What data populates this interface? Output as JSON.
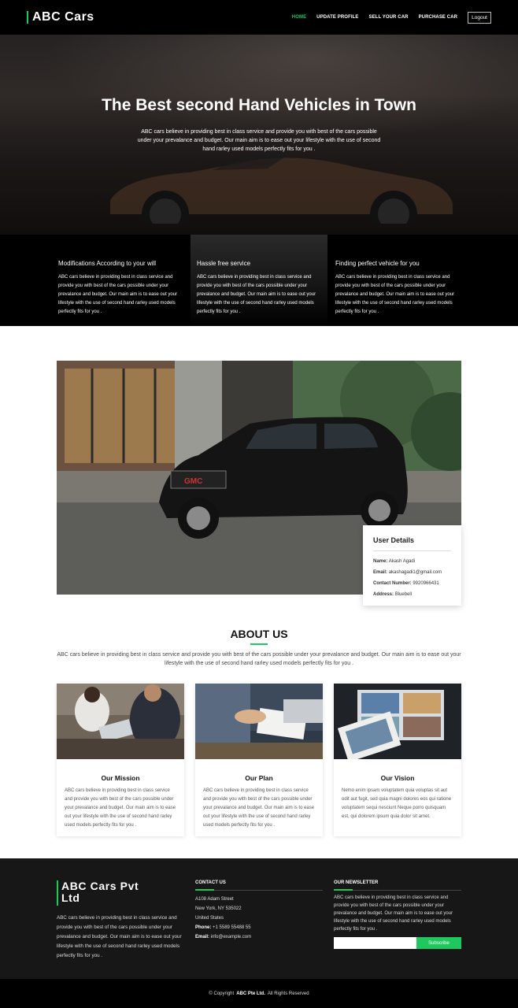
{
  "nav": {
    "brand": "ABC Cars",
    "links": [
      "HOME",
      "UPDATE PROFILE",
      "SELL YOUR CAR",
      "PURCHASE CAR"
    ],
    "logout": "Logout"
  },
  "hero": {
    "title": "The Best second Hand Vehicles in Town",
    "text": "ABC cars believe in providing best in class service and provide you with best of the cars possible under your prevalance and budget. Our main aim is to ease out your lifestyle with the use of second hand rarley used models perfectly fits for you ."
  },
  "features": [
    {
      "title": "Modifications According to your will",
      "text": "ABC cars believe in providing best in class service and provide you with best of the cars possible under your prevalance and budget. Our main aim is to ease out your lifestyle with the use of second hand rarley used models perfectly fits for you ."
    },
    {
      "title": "Hassle free service",
      "text": "ABC cars believe in providing best in class service and provide you with best of the cars possible under your prevalance and budget. Our main aim is to ease out your lifestyle with the use of second hand rarley used models perfectly fits for you ."
    },
    {
      "title": "Finding perfect vehicle for you",
      "text": "ABC cars believe in providing best in class service and provide you with best of the cars possible under your prevalance and budget. Our main aim is to ease out your lifestyle with the use of second hand rarley used models perfectly fits for you ."
    }
  ],
  "user": {
    "title": "User Details",
    "name_label": "Name:",
    "name": "Akash Agadi",
    "email_label": "Email:",
    "email": "akashagadi1@gmail.com",
    "phone_label": "Contact Number:",
    "phone": "9920966431",
    "address_label": "Address:",
    "address": "Bluebell"
  },
  "about": {
    "title": "ABOUT US",
    "text": "ABC cars believe in providing best in class service and provide you with best of the cars possible under your prevalance and budget. Our main aim is to ease out your lifestyle with the use of second hand rarley used models perfectly fits for you .",
    "cards": [
      {
        "title": "Our Mission",
        "text": "ABC cars believe in providing best in class service and provide you with best of the cars possible under your prevalance and budget. Our main aim is to ease out your lifestyle with the use of second hand rarley used models perfectly fits for you ."
      },
      {
        "title": "Our Plan",
        "text": "ABC cars believe in providing best in class service and provide you with best of the cars possible under your prevalance and budget. Our main aim is to ease out your lifestyle with the use of second hand rarley used models perfectly fits for you ."
      },
      {
        "title": "Our Vision",
        "text": "Nemo enim ipsam voluptatem quia voluptas sit aut odit aut fugit, sed quia magni dolores eos qui ratione voluptatem sequi nesciunt Neque porro quisquam est, qui dolorem ipsum quia dolor sit amet."
      }
    ]
  },
  "footer": {
    "brand_line1": "ABC Cars Pvt",
    "brand_line2": "Ltd",
    "desc": "ABC cars believe in providing best in class service and provide you with best of the cars possible under your prevalance and budget. Our main aim is to ease out your lifestyle with the use of second hand rarley used models perfectly fits for you .",
    "contact_title": "CONTACT US",
    "address1": "A108 Adam Street",
    "address2": "New York, NY 535022",
    "country": "United States",
    "phone_label": "Phone:",
    "phone": "+1 5589 55488 55",
    "email_label": "Email:",
    "email": "info@example.com",
    "news_title": "OUR NEWSLETTER",
    "news_text": "ABC cars believe in providing best in class service and provide you with best of the cars possible under your prevalance and budget. Our main aim is to ease out your lifestyle with the use of second hand rarley used models perfectly fits for you .",
    "subscribe": "Subscribe",
    "copyright_prefix": "© Copyright",
    "copyright_company": "ABC Pte Ltd.",
    "copyright_suffix": "All Rights Reserved"
  },
  "colors": {
    "accent": "#1fc85f",
    "dark": "#000000",
    "footer": "#171717"
  }
}
